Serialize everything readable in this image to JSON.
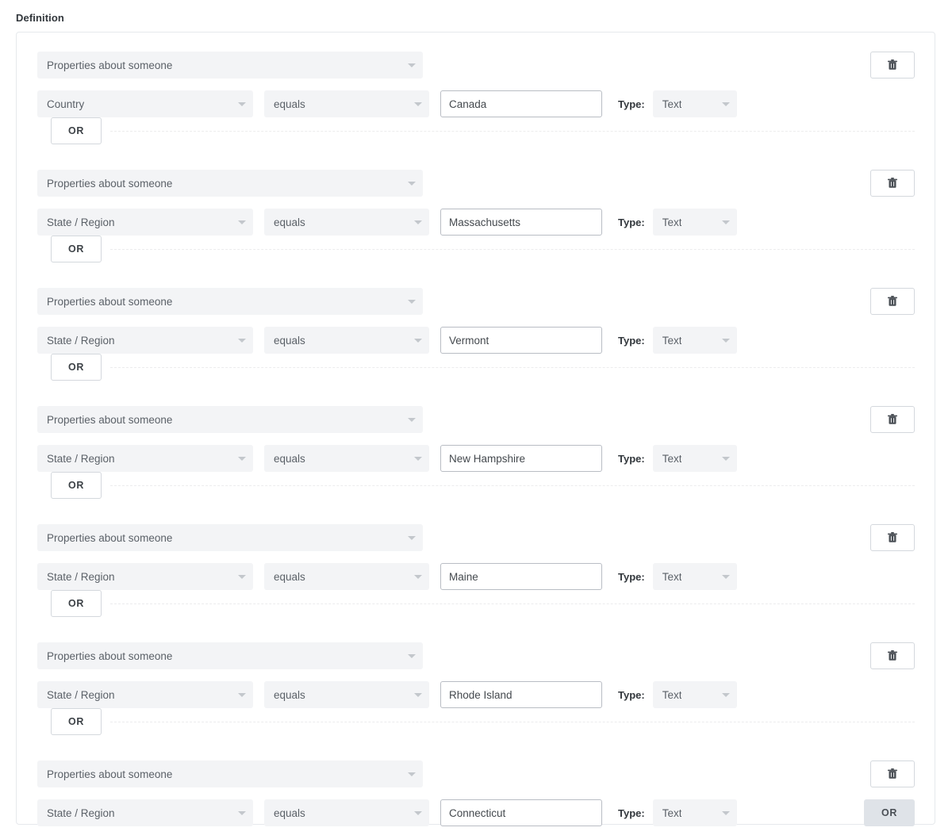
{
  "section": {
    "label": "Definition"
  },
  "labels": {
    "type_label": "Type:",
    "or_label": "OR",
    "trash_icon": "trash-icon",
    "caret_icon": "chevron-down-icon"
  },
  "colors": {
    "select_bg": "#f3f4f6",
    "panel_border": "#e6e9ec",
    "input_border": "#b9bdc4",
    "button_border": "#d4d8dd",
    "or_active_bg": "#dfe3e8",
    "text_primary": "#32373c",
    "text_select": "#5b6168",
    "dashed_divider": "#ececed"
  },
  "groups": [
    {
      "object": "Properties about someone",
      "field": "Country",
      "operator": "equals",
      "value": "Canada",
      "value_placeholder": "",
      "type": "Text",
      "delete_label": "",
      "show_or_separator": true,
      "show_trailing_or": false
    },
    {
      "object": "Properties about someone",
      "field": "State / Region",
      "operator": "equals",
      "value": "Massachusetts",
      "value_placeholder": "",
      "type": "Text",
      "delete_label": "",
      "show_or_separator": true,
      "show_trailing_or": false
    },
    {
      "object": "Properties about someone",
      "field": "State / Region",
      "operator": "equals",
      "value": "Vermont",
      "value_placeholder": "",
      "type": "Text",
      "delete_label": "",
      "show_or_separator": true,
      "show_trailing_or": false
    },
    {
      "object": "Properties about someone",
      "field": "State / Region",
      "operator": "equals",
      "value": "New Hampshire",
      "value_placeholder": "",
      "type": "Text",
      "delete_label": "",
      "show_or_separator": true,
      "show_trailing_or": false
    },
    {
      "object": "Properties about someone",
      "field": "State / Region",
      "operator": "equals",
      "value": "Maine",
      "value_placeholder": "",
      "type": "Text",
      "delete_label": "",
      "show_or_separator": true,
      "show_trailing_or": false
    },
    {
      "object": "Properties about someone",
      "field": "State / Region",
      "operator": "equals",
      "value": "Rhode Island",
      "value_placeholder": "",
      "type": "Text",
      "delete_label": "",
      "show_or_separator": true,
      "show_trailing_or": false
    },
    {
      "object": "Properties about someone",
      "field": "State / Region",
      "operator": "equals",
      "value": "Connecticut",
      "value_placeholder": "",
      "type": "Text",
      "delete_label": "",
      "show_or_separator": false,
      "show_trailing_or": true
    }
  ]
}
